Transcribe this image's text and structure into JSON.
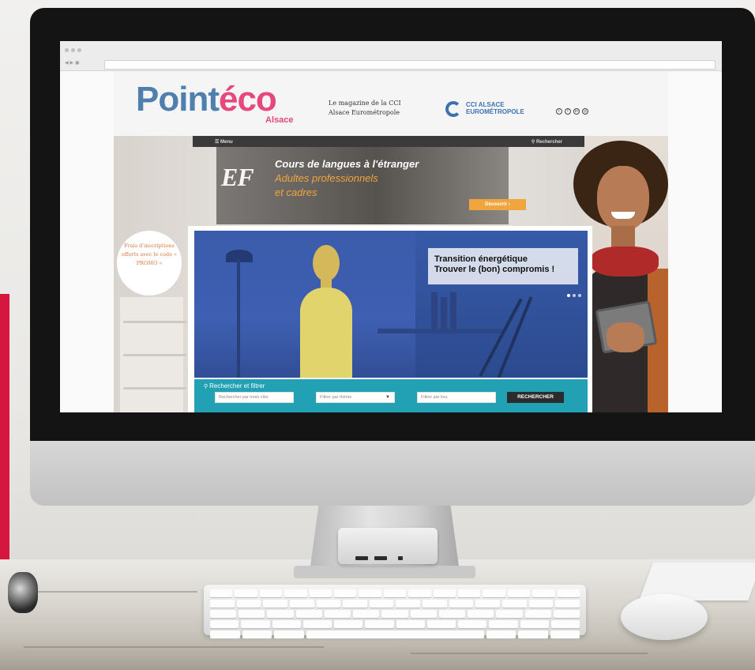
{
  "site": {
    "logo_point": "Point",
    "logo_eco": "éco",
    "logo_sub": "Alsace",
    "tagline": "Le magazine de la CCI Alsace Eurométropole",
    "cci_name": "CCI ALSACE EUROMÉTROPOLE"
  },
  "nav": {
    "menu_label": "☰ Menu",
    "search_label": "Rechercher"
  },
  "ad": {
    "brand": "EF",
    "line1": "Cours de langues à l'étranger",
    "line2": "Adultes professionnels",
    "line3": "et cadres",
    "button": "Découvrir ›"
  },
  "promo": {
    "text": "Frais d'inscriptions offerts avec le code « PROMO »"
  },
  "article": {
    "title_line1": "Transition énergétique",
    "title_line2": "Trouver le (bon) compromis !"
  },
  "search": {
    "title": "Rechercher et filtrer",
    "keyword_placeholder": "Rechercher par mots clés",
    "theme_placeholder": "Filtrer par thème",
    "place_placeholder": "Filtrer par lieu",
    "button": "RECHERCHER"
  },
  "social_icons": [
    "twitter-icon",
    "facebook-icon",
    "linkedin-icon",
    "instagram-icon"
  ],
  "colors": {
    "logo_blue": "#4f7fae",
    "logo_pink": "#e8477e",
    "cci_blue": "#3d71b1",
    "accent_orange": "#f0a53d",
    "search_teal": "#22a1b5",
    "brand_red": "#d5173f"
  }
}
